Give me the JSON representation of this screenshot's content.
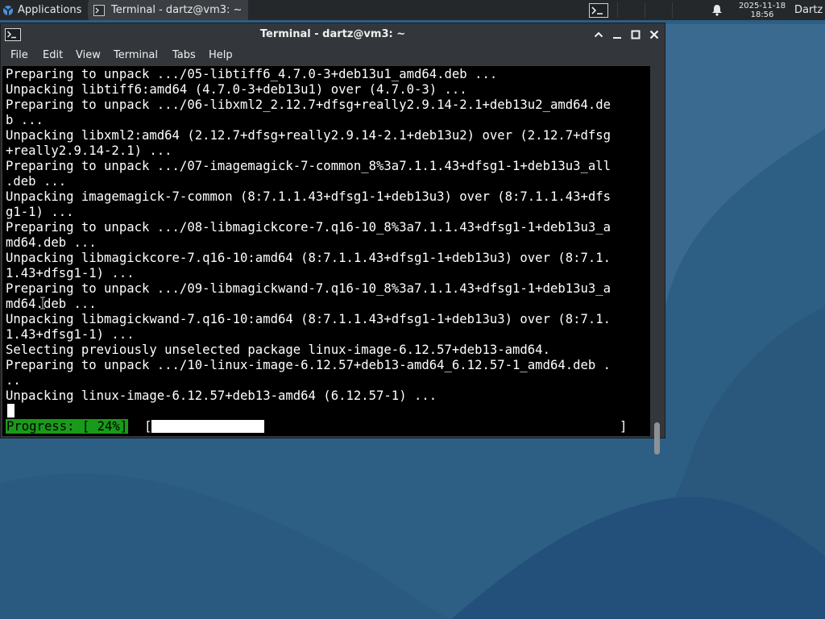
{
  "panel": {
    "applications_label": "Applications",
    "task_label": "Terminal - dartz@vm3: ~",
    "clock_date": "2025-11-18",
    "clock_time": "18:56",
    "user_label": "Dartz"
  },
  "window": {
    "title": "Terminal - dartz@vm3: ~",
    "menu": [
      "File",
      "Edit",
      "View",
      "Terminal",
      "Tabs",
      "Help"
    ]
  },
  "terminal": {
    "lines": [
      "Preparing to unpack .../05-libtiff6_4.7.0-3+deb13u1_amd64.deb ...",
      "Unpacking libtiff6:amd64 (4.7.0-3+deb13u1) over (4.7.0-3) ...",
      "Preparing to unpack .../06-libxml2_2.12.7+dfsg+really2.9.14-2.1+deb13u2_amd64.de",
      "b ...",
      "Unpacking libxml2:amd64 (2.12.7+dfsg+really2.9.14-2.1+deb13u2) over (2.12.7+dfsg",
      "+really2.9.14-2.1) ...",
      "Preparing to unpack .../07-imagemagick-7-common_8%3a7.1.1.43+dfsg1-1+deb13u3_all",
      ".deb ...",
      "Unpacking imagemagick-7-common (8:7.1.1.43+dfsg1-1+deb13u3) over (8:7.1.1.43+dfs",
      "g1-1) ...",
      "Preparing to unpack .../08-libmagickcore-7.q16-10_8%3a7.1.1.43+dfsg1-1+deb13u3_a",
      "md64.deb ...",
      "Unpacking libmagickcore-7.q16-10:amd64 (8:7.1.1.43+dfsg1-1+deb13u3) over (8:7.1.",
      "1.43+dfsg1-1) ...",
      "Preparing to unpack .../09-libmagickwand-7.q16-10_8%3a7.1.1.43+dfsg1-1+deb13u3_a",
      "md64.deb ...",
      "Unpacking libmagickwand-7.q16-10:amd64 (8:7.1.1.43+dfsg1-1+deb13u3) over (8:7.1.",
      "1.43+dfsg1-1) ...",
      "Selecting previously unselected package linux-image-6.12.57+deb13-amd64.",
      "Preparing to unpack .../10-linux-image-6.12.57+deb13-amd64_6.12.57-1_amd64.deb .",
      "..",
      "Unpacking linux-image-6.12.57+deb13-amd64 (6.12.57-1) ..."
    ],
    "progress_label": "Progress: [ 24%]",
    "progress_open": "[",
    "progress_close": "]",
    "progress_fraction": 0.24
  },
  "colors": {
    "progress_label_bg": "#1a9a1a",
    "terminal_bg": "#000000",
    "titlebar_bg": "#33373b"
  },
  "icons": {
    "apps": "xfce-logo-icon",
    "terminal": "terminal-icon",
    "bell": "bell-icon"
  }
}
